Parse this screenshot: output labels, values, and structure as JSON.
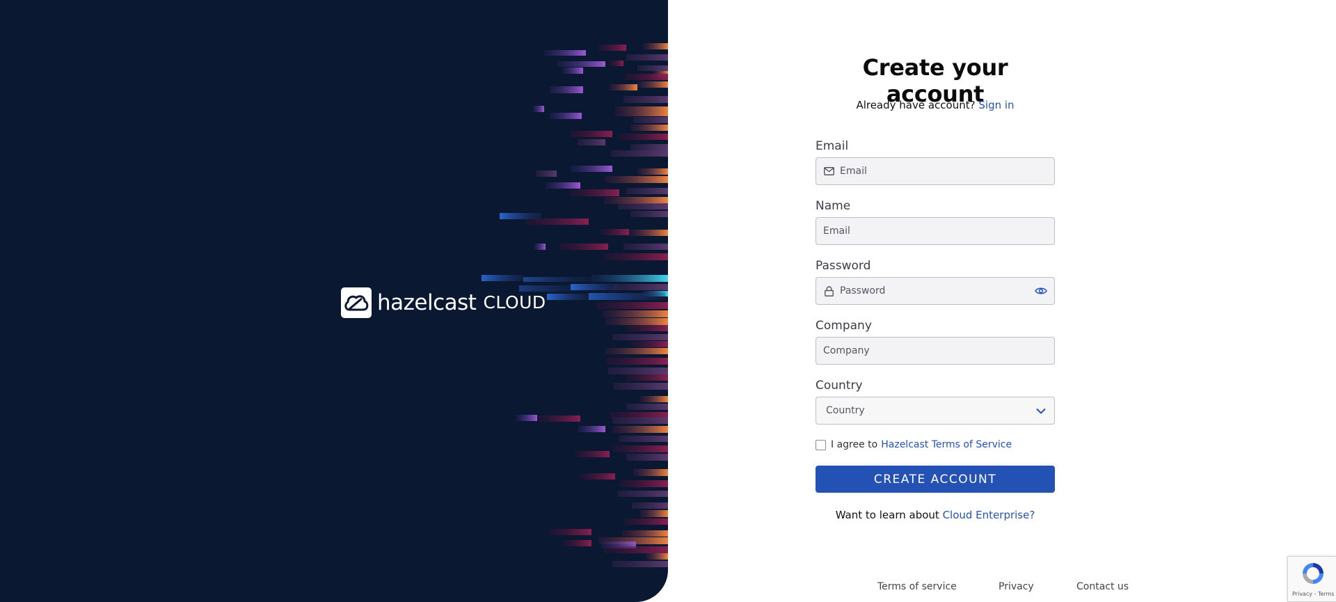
{
  "brand": {
    "wordmark": "hazelcast",
    "product": "CLOUD"
  },
  "form": {
    "title": "Create your account",
    "signin_prompt": "Already have account?",
    "signin_link": "Sign in",
    "fields": {
      "email": {
        "label": "Email",
        "placeholder": "Email",
        "icon": "mail-icon"
      },
      "name": {
        "label": "Name",
        "placeholder": "Email"
      },
      "password": {
        "label": "Password",
        "placeholder": "Password",
        "icon": "lock-icon",
        "toggle_icon": "eye-icon"
      },
      "company": {
        "label": "Company",
        "placeholder": "Company"
      },
      "country": {
        "label": "Country",
        "selected": "Country",
        "icon": "chevron-down-icon"
      }
    },
    "agree_text": "I agree to",
    "terms_link": "Hazelcast Terms of Service",
    "submit": "CREATE ACCOUNT",
    "learn_prompt": "Want to learn about",
    "learn_link": "Cloud Enterprise?"
  },
  "footer": {
    "links": [
      "Terms of service",
      "Privacy",
      "Contact us"
    ]
  },
  "recaptcha": {
    "text": "Privacy - Terms"
  },
  "colors": {
    "brand_panel": "#0b1832",
    "accent": "#2452b4",
    "streak_orange": "#ee7a3c",
    "streak_purple": "#8b52c8",
    "streak_cyan": "#3fd2ec",
    "streak_blue": "#2b63c9",
    "streak_magenta": "#7a1d4a"
  }
}
